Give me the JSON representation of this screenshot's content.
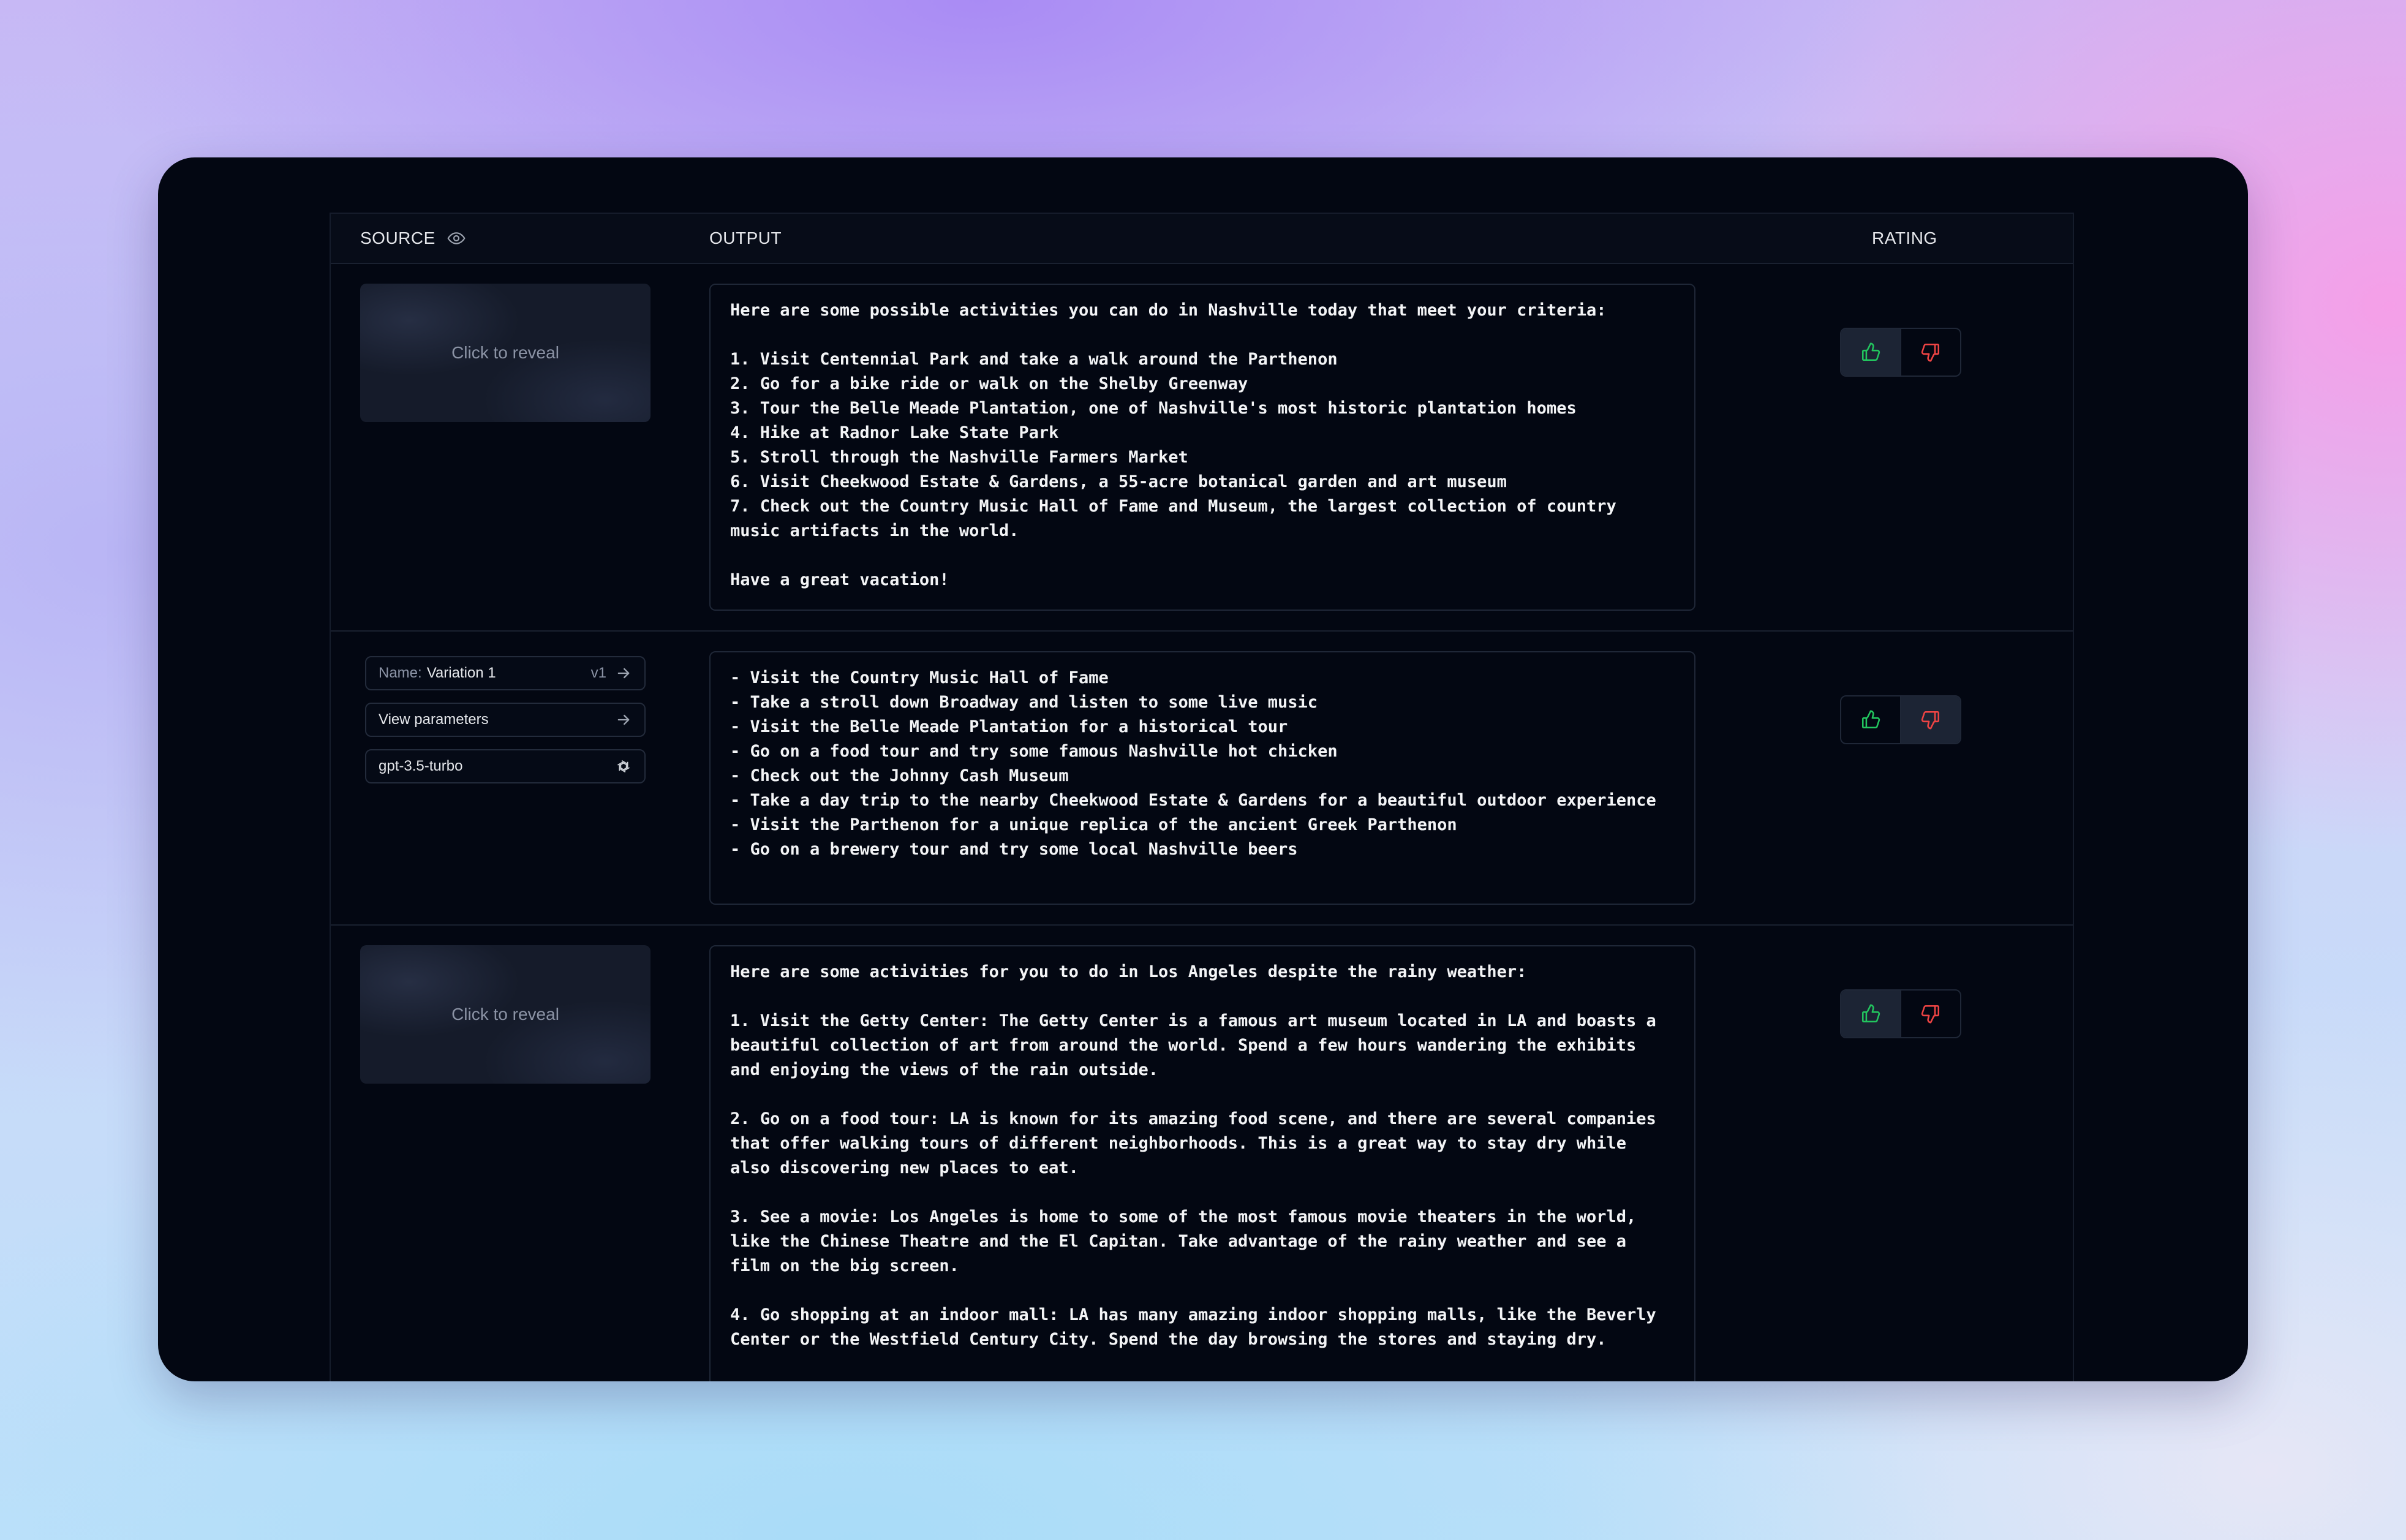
{
  "table": {
    "headers": {
      "source": "SOURCE",
      "output": "OUTPUT",
      "rating": "RATING"
    }
  },
  "rows": [
    {
      "source": {
        "reveal_label": "Click to reveal"
      },
      "output": "Here are some possible activities you can do in Nashville today that meet your criteria:\n\n1. Visit Centennial Park and take a walk around the Parthenon\n2. Go for a bike ride or walk on the Shelby Greenway\n3. Tour the Belle Meade Plantation, one of Nashville's most historic plantation homes\n4. Hike at Radnor Lake State Park\n5. Stroll through the Nashville Farmers Market\n6. Visit Cheekwood Estate & Gardens, a 55-acre botanical garden and art museum\n7. Check out the Country Music Hall of Fame and Museum, the largest collection of country music artifacts in the world.\n\nHave a great vacation!",
      "rating": "up"
    },
    {
      "source": {
        "name_label": "Name:",
        "name_value": "Variation 1",
        "version": "v1",
        "parameters_label": "View parameters",
        "model": "gpt-3.5-turbo"
      },
      "output": "- Visit the Country Music Hall of Fame\n- Take a stroll down Broadway and listen to some live music\n- Visit the Belle Meade Plantation for a historical tour\n- Go on a food tour and try some famous Nashville hot chicken\n- Check out the Johnny Cash Museum\n- Take a day trip to the nearby Cheekwood Estate & Gardens for a beautiful outdoor experience\n- Visit the Parthenon for a unique replica of the ancient Greek Parthenon\n- Go on a brewery tour and try some local Nashville beers",
      "rating": "down"
    },
    {
      "source": {
        "reveal_label": "Click to reveal"
      },
      "output": "Here are some activities for you to do in Los Angeles despite the rainy weather:\n\n1. Visit the Getty Center: The Getty Center is a famous art museum located in LA and boasts a beautiful collection of art from around the world. Spend a few hours wandering the exhibits and enjoying the views of the rain outside.\n\n2. Go on a food tour: LA is known for its amazing food scene, and there are several companies that offer walking tours of different neighborhoods. This is a great way to stay dry while also discovering new places to eat.\n\n3. See a movie: Los Angeles is home to some of the most famous movie theaters in the world, like the Chinese Theatre and the El Capitan. Take advantage of the rainy weather and see a film on the big screen.\n\n4. Go shopping at an indoor mall: LA has many amazing indoor shopping malls, like the Beverly Center or the Westfield Century City. Spend the day browsing the stores and staying dry.",
      "rating": "up"
    }
  ],
  "colors": {
    "thumb_up": "#22c55e",
    "thumb_down": "#ef4444"
  },
  "icons": [
    "eye-icon",
    "thumbs-up-icon",
    "thumbs-down-icon",
    "arrow-right-icon",
    "openai-logo-icon"
  ]
}
